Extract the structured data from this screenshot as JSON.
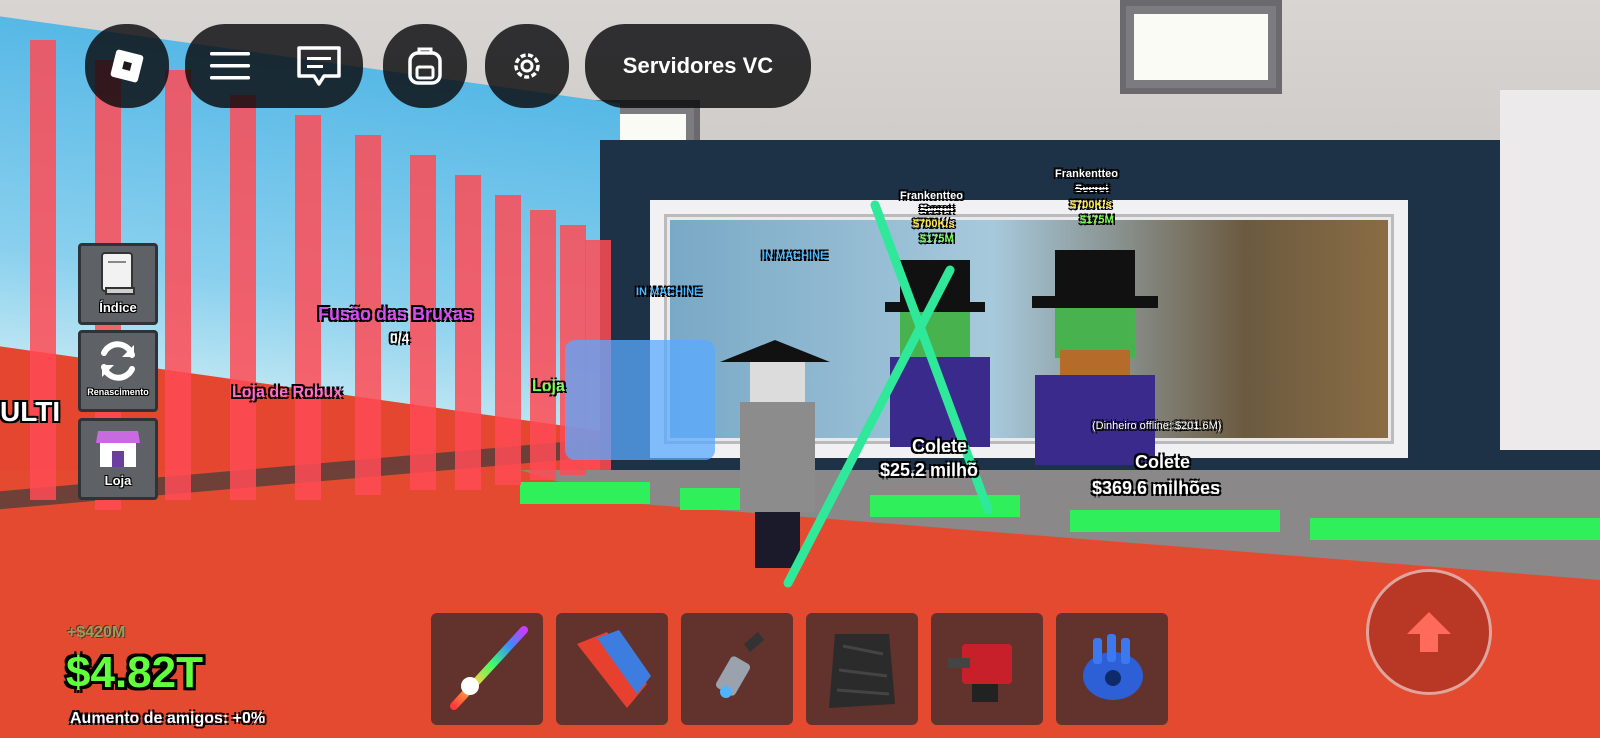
{
  "topbar": {
    "roblox_logo_icon": "roblox-logo-icon",
    "menu_icon": "hamburger-menu-icon",
    "chat_icon": "chat-icon",
    "backpack_icon": "backpack-icon",
    "settings_icon": "gear-icon",
    "voice_servers_label": "Servidores VC"
  },
  "side_menu": {
    "items": [
      {
        "label": "Índice",
        "icon": "book-icon"
      },
      {
        "label": "Renascimento",
        "icon": "refresh-icon"
      },
      {
        "label": "Loja",
        "icon": "store-icon"
      }
    ],
    "partial_sign": "ULTI"
  },
  "world": {
    "fusion_title": "Fusão das Bruxas",
    "fusion_count": "0/4",
    "robux_shop": "Loja de Robux",
    "shop_sign": "Loja",
    "in_machine_1": "IN MACHINE",
    "in_machine_2": "IN MACHINE",
    "brainrots": [
      {
        "name": "Frankentteo",
        "rarity": "Secret",
        "rate": "$700K/s",
        "price": "$175M",
        "collect": "Colete",
        "amount": "$25.2 milhõ"
      },
      {
        "name": "Frankentteo",
        "rarity": "Secret",
        "rate": "$700K/s",
        "price": "$175M",
        "collect": "Colete",
        "amount": "$369.6 milhões",
        "offline": "(Dinheiro offline: $201.6M)"
      }
    ]
  },
  "hotbar": {
    "slots": [
      {
        "item": "unicorn-rainbow-sword-icon"
      },
      {
        "item": "red-blue-gear-icon"
      },
      {
        "item": "grapple-hook-icon"
      },
      {
        "item": "dark-cloak-icon"
      },
      {
        "item": "red-turret-icon"
      },
      {
        "item": "blue-gauntlet-icon"
      }
    ]
  },
  "stats": {
    "recent_gain": "+$420M",
    "money": "$4.82T",
    "friends_boost": "Aumento de amigos: +0%"
  },
  "controls": {
    "jump_icon": "jump-arrow-icon"
  },
  "colors": {
    "money_green": "#62ff3c",
    "laser_red": "#ff4b55",
    "floor_red": "#e44a30",
    "x_mark_green": "#2fe89a"
  }
}
